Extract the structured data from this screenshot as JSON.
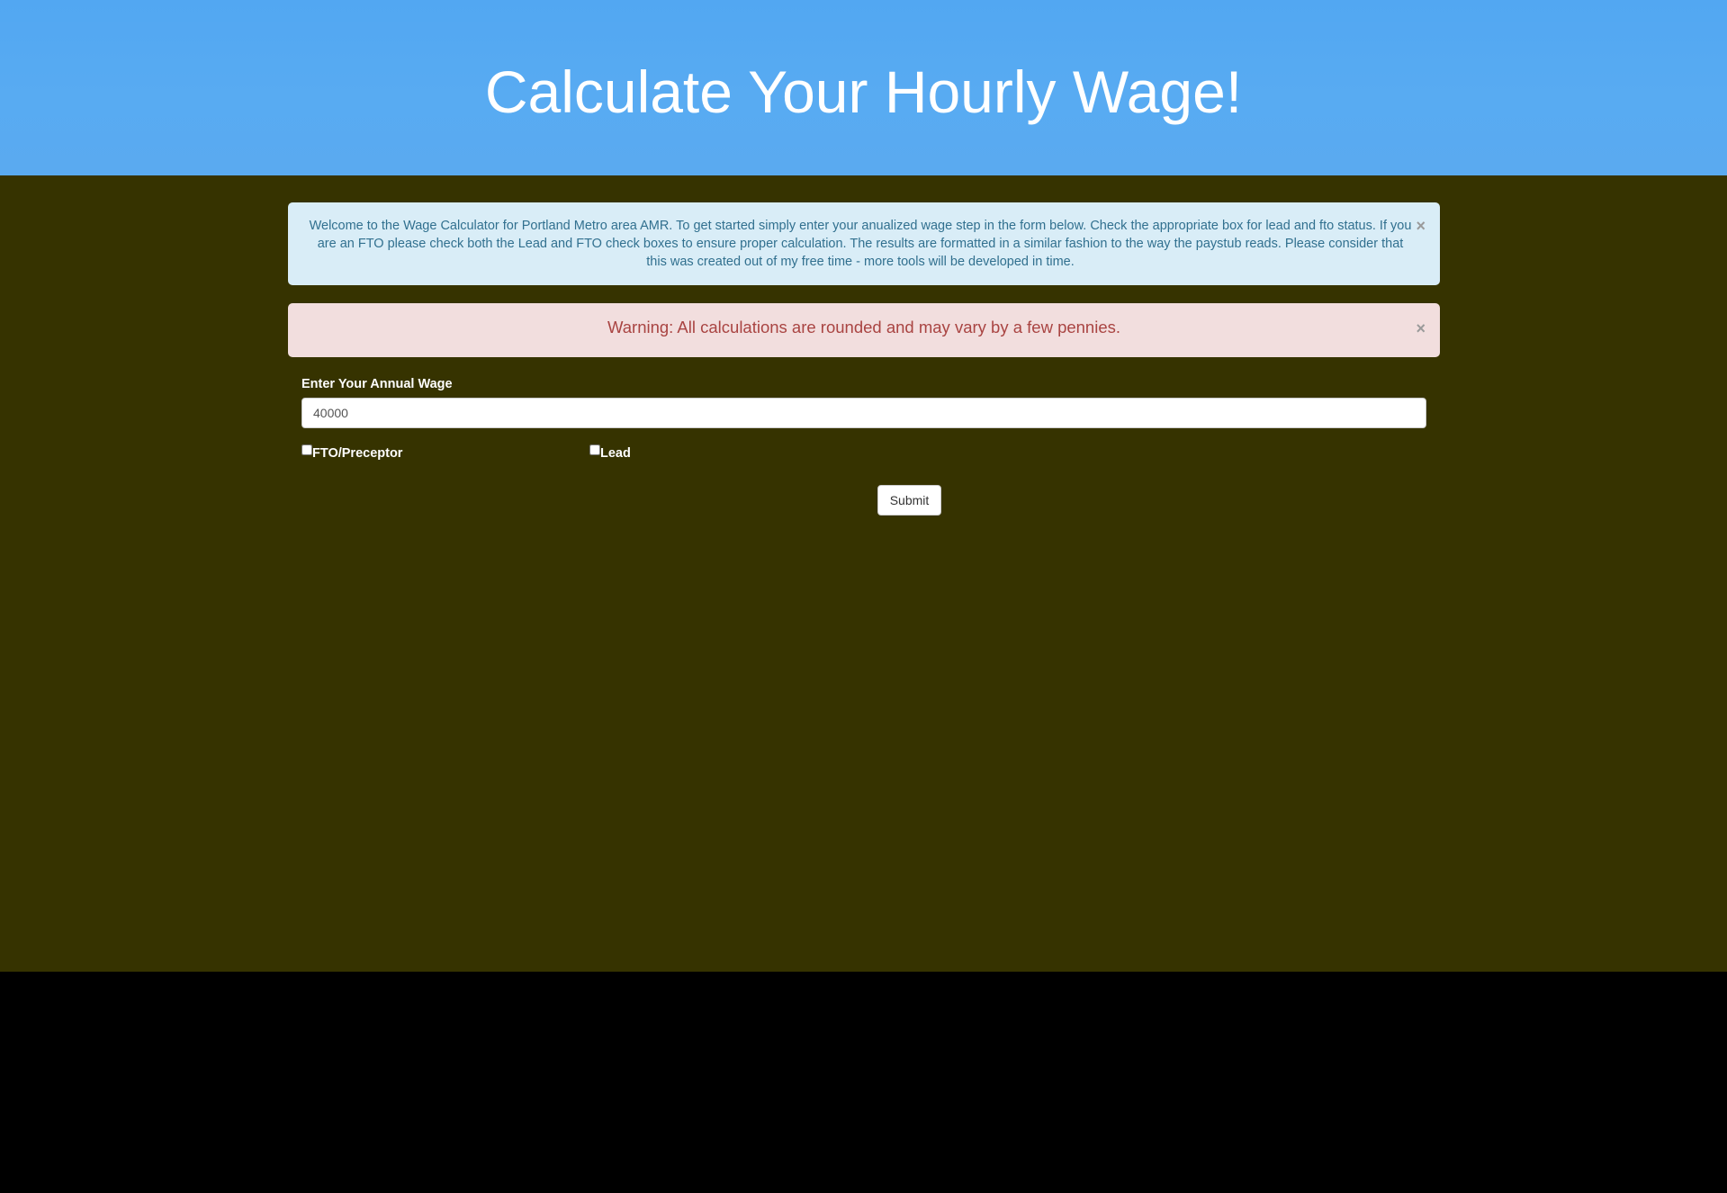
{
  "header": {
    "title": "Calculate Your Hourly Wage!"
  },
  "alerts": {
    "info": {
      "text": "Welcome to the Wage Calculator for Portland Metro area AMR. To get started simply enter your anualized wage step in the form below. Check the appropriate box for lead and fto status. If you are an FTO please check both the Lead and FTO check boxes to ensure proper calculation. The results are formatted in a similar fashion to the way the paystub reads. Please consider that this was created out of my free time - more tools will be developed in time.",
      "close": "×"
    },
    "warning": {
      "text": "Warning: All calculations are rounded and may vary by a few pennies.",
      "close": "×"
    }
  },
  "form": {
    "wage_label": "Enter Your Annual Wage",
    "wage_value": "40000",
    "fto_label": "FTO/Preceptor",
    "lead_label": "Lead",
    "submit_label": "Submit"
  },
  "colors": {
    "header_bg": "#58abf2",
    "main_bg": "#363300",
    "footer_bg": "#000000",
    "info_bg": "#d9edf7",
    "info_text": "#31708f",
    "warning_bg": "#f2dede",
    "warning_text": "#a94442"
  },
  "icons": {
    "close": "close-icon"
  }
}
